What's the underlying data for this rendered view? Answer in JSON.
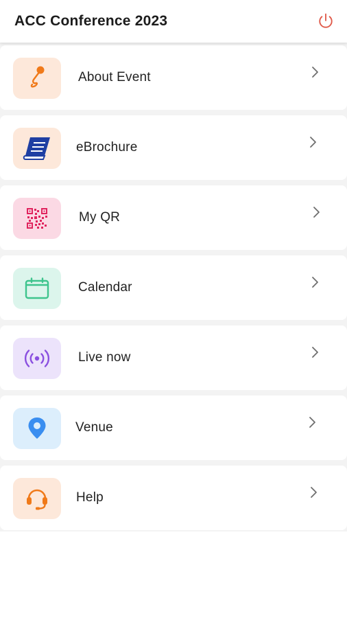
{
  "header": {
    "title": "ACC Conference 2023",
    "power_icon": "power-icon"
  },
  "menu": {
    "items": [
      {
        "id": "about-event",
        "label": "About Event",
        "icon": "microphone-icon",
        "tile_color": "#fde8da",
        "icon_color": "#f07a1a"
      },
      {
        "id": "ebrochure",
        "label": "eBrochure",
        "icon": "book-icon",
        "tile_color": "#fde8da",
        "icon_color": "#1f3fa3"
      },
      {
        "id": "my-qr",
        "label": "My QR",
        "icon": "qr-code-icon",
        "tile_color": "#fbd9e4",
        "icon_color": "#e0245e"
      },
      {
        "id": "calendar",
        "label": "Calendar",
        "icon": "calendar-icon",
        "tile_color": "#dcf5ec",
        "icon_color": "#3ec48d"
      },
      {
        "id": "live-now",
        "label": "Live now",
        "icon": "broadcast-icon",
        "tile_color": "#ece3fb",
        "icon_color": "#8a4fe0"
      },
      {
        "id": "venue",
        "label": "Venue",
        "icon": "location-pin-icon",
        "tile_color": "#dceefc",
        "icon_color": "#3a8ef0"
      },
      {
        "id": "help",
        "label": "Help",
        "icon": "headset-icon",
        "tile_color": "#fde8da",
        "icon_color": "#f07a1a"
      }
    ]
  },
  "colors": {
    "power_icon": "#e05a4a",
    "chevron": "#6e6e6e",
    "list_background": "#f3f3f3"
  }
}
